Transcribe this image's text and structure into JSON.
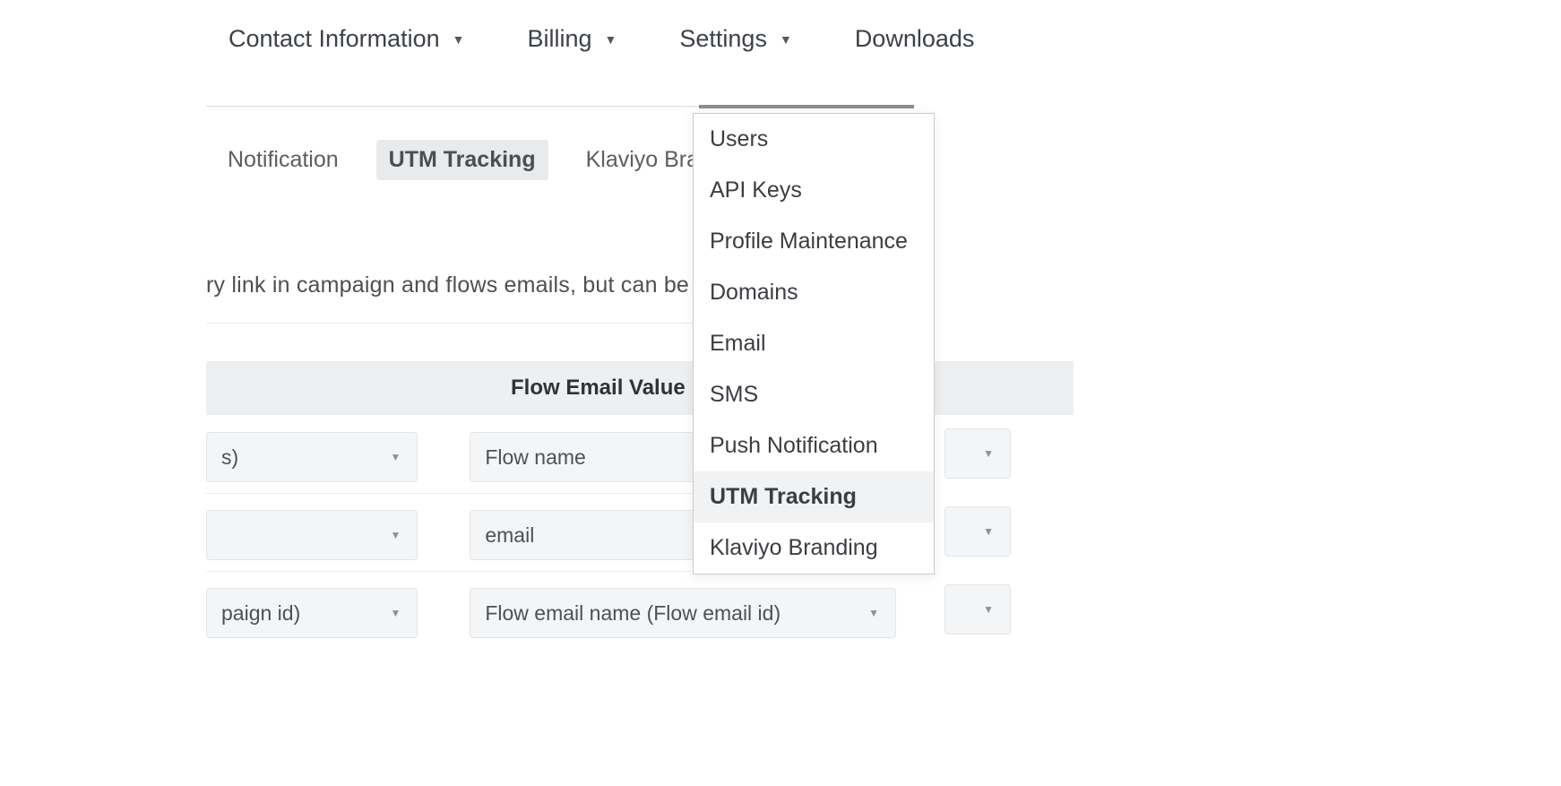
{
  "topnav": {
    "contact": "Contact Information",
    "billing": "Billing",
    "settings": "Settings",
    "downloads": "Downloads"
  },
  "subtabs": {
    "notification": "Notification",
    "utm": "UTM Tracking",
    "branding": "Klaviyo Branding"
  },
  "description": "ry link in campaign and flows emails, but can be c",
  "table": {
    "header": "Flow Email Value",
    "rows": [
      {
        "left": "s)",
        "right": "Flow name"
      },
      {
        "left": "",
        "right": "email"
      },
      {
        "left": "paign id)",
        "right": "Flow email name (Flow email id)"
      }
    ]
  },
  "settings_menu": [
    "Users",
    "API Keys",
    "Profile Maintenance",
    "Domains",
    "Email",
    "SMS",
    "Push Notification",
    "UTM Tracking",
    "Klaviyo Branding"
  ],
  "settings_menu_active_index": 7
}
